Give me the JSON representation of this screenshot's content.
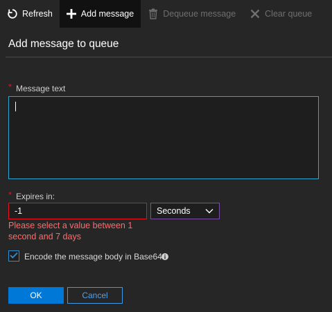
{
  "toolbar": {
    "refresh_label": "Refresh",
    "add_label": "Add message",
    "dequeue_label": "Dequeue message",
    "clear_label": "Clear queue"
  },
  "panel": {
    "title": "Add message to queue"
  },
  "message_field": {
    "label": "Message text",
    "required_mark": "*",
    "value": ""
  },
  "expires_field": {
    "label": "Expires in:",
    "required_mark": "*",
    "value": "-1",
    "unit_selected": "Seconds",
    "error": "Please select a value between 1 second and 7 days"
  },
  "encode": {
    "label": "Encode the message body in Base64",
    "checked": true
  },
  "buttons": {
    "ok": "OK",
    "cancel": "Cancel"
  },
  "colors": {
    "accent": "#0078d7",
    "error": "#e81123",
    "focus_border": "#2aa8d4",
    "select_border": "#7c4ea3"
  }
}
